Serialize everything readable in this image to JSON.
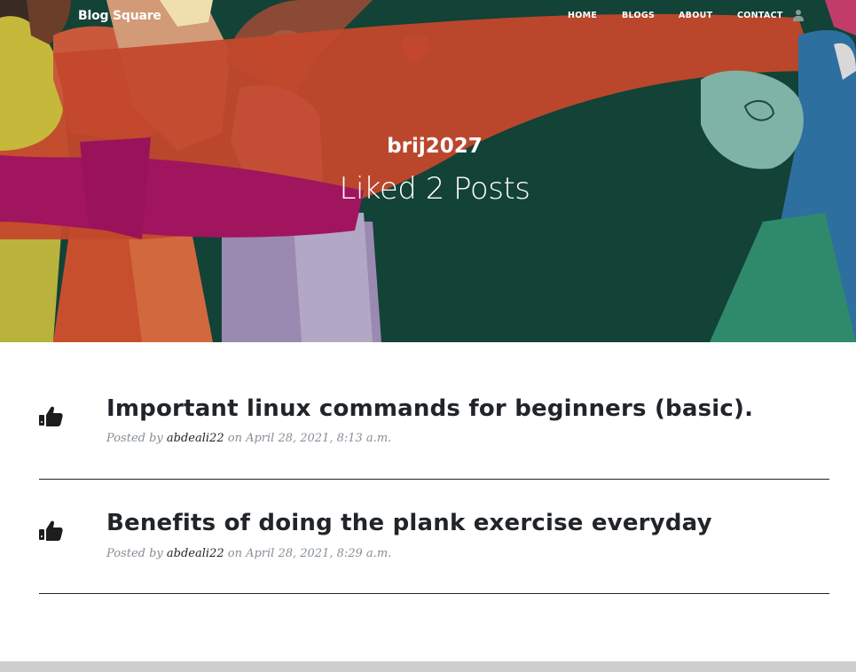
{
  "brand": "Blog Square",
  "nav": {
    "home": "HOME",
    "blogs": "BLOGS",
    "about": "ABOUT",
    "contact": "CONTACT",
    "user_icon": "user-icon"
  },
  "hero": {
    "username": "brij2027",
    "subtitle": "Liked 2 Posts"
  },
  "posts": [
    {
      "icon": "thumbs-up-icon",
      "title": "Important linux commands for beginners (basic).",
      "posted_by": "Posted by",
      "author": "abdeali22",
      "on": "on April 28, 2021, 8:13 a.m."
    },
    {
      "icon": "thumbs-up-icon",
      "title": "Benefits of doing the plank exercise everyday",
      "posted_by": "Posted by",
      "author": "abdeali22",
      "on": "on April 28, 2021, 8:29 a.m."
    }
  ],
  "colors": {
    "hero_bg": "#134236",
    "ribbon": "#c3482c",
    "magenta": "#a0155e",
    "text": "#212529",
    "meta": "#868e96"
  }
}
